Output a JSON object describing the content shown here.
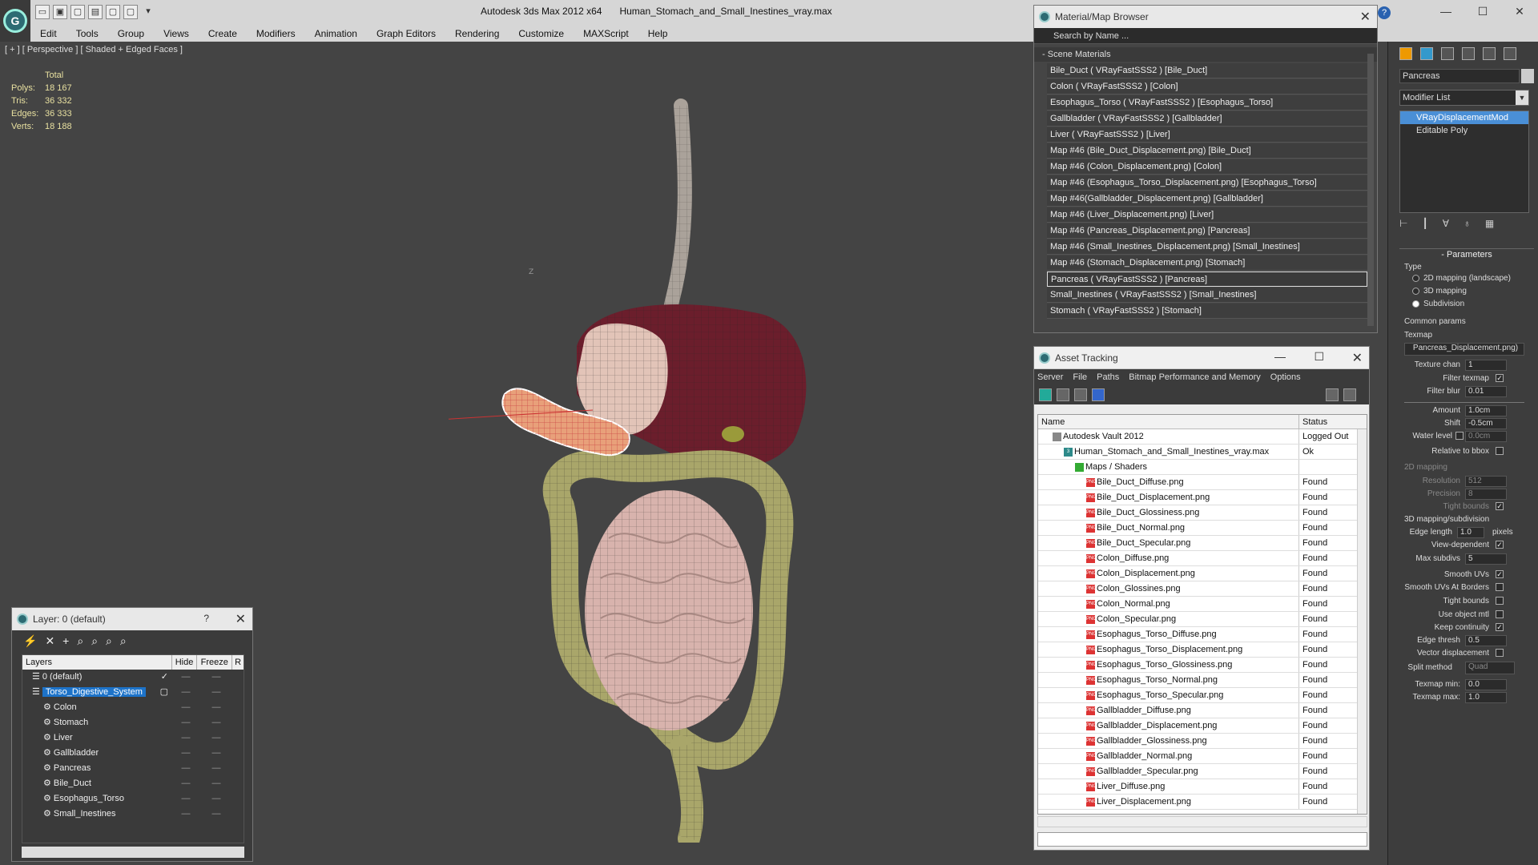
{
  "app": {
    "title": "Autodesk 3ds Max  2012 x64",
    "file": "Human_Stomach_and_Small_Inestines_vray.max",
    "help": "?"
  },
  "menu": [
    "Edit",
    "Tools",
    "Group",
    "Views",
    "Create",
    "Modifiers",
    "Animation",
    "Graph Editors",
    "Rendering",
    "Customize",
    "MAXScript",
    "Help"
  ],
  "viewport": {
    "label": "[ + ] [ Perspective ] [ Shaded + Edged Faces ]",
    "stats_header": "Total",
    "stats": [
      {
        "k": "Polys:",
        "v": "18 167"
      },
      {
        "k": "Tris:",
        "v": "36 332"
      },
      {
        "k": "Edges:",
        "v": "36 333"
      },
      {
        "k": "Verts:",
        "v": "18 188"
      }
    ],
    "axis_z": "Z",
    "axis_x": "X"
  },
  "material_browser": {
    "title": "Material/Map Browser",
    "search_placeholder": "Search by Name ...",
    "section": "Scene Materials",
    "items": [
      "Bile_Duct  ( VRayFastSSS2 )  [Bile_Duct]",
      "Colon  ( VRayFastSSS2 )  [Colon]",
      "Esophagus_Torso  ( VRayFastSSS2 )  [Esophagus_Torso]",
      "Gallbladder  ( VRayFastSSS2 )  [Gallbladder]",
      "Liver  ( VRayFastSSS2 )  [Liver]",
      "Map #46 (Bile_Duct_Displacement.png)  [Bile_Duct]",
      "Map #46 (Colon_Displacement.png)  [Colon]",
      "Map #46 (Esophagus_Torso_Displacement.png)  [Esophagus_Torso]",
      "Map #46(Gallbladder_Displacement.png)  [Gallbladder]",
      "Map #46 (Liver_Displacement.png)  [Liver]",
      "Map #46 (Pancreas_Displacement.png)  [Pancreas]",
      "Map #46 (Small_Inestines_Displacement.png)  [Small_Inestines]",
      "Map #46 (Stomach_Displacement.png)  [Stomach]",
      "Pancreas  ( VRayFastSSS2 )  [Pancreas]",
      "Small_Inestines  ( VRayFastSSS2 )  [Small_Inestines]",
      "Stomach  ( VRayFastSSS2 )  [Stomach]"
    ],
    "selected_index": 13
  },
  "asset_tracking": {
    "title": "Asset Tracking",
    "menu": [
      "Server",
      "File",
      "Paths",
      "Bitmap Performance and Memory",
      "Options"
    ],
    "columns": [
      "Name",
      "Status"
    ],
    "rows": [
      {
        "name": "Autodesk Vault 2012",
        "status": "Logged Out",
        "indent": 1,
        "icon": "vault"
      },
      {
        "name": "Human_Stomach_and_Small_Inestines_vray.max",
        "status": "Ok",
        "indent": 2,
        "icon": "max"
      },
      {
        "name": "Maps / Shaders",
        "status": "",
        "indent": 3,
        "icon": "maps"
      },
      {
        "name": "Bile_Duct_Diffuse.png",
        "status": "Found",
        "indent": 4,
        "icon": "png"
      },
      {
        "name": "Bile_Duct_Displacement.png",
        "status": "Found",
        "indent": 4,
        "icon": "png"
      },
      {
        "name": "Bile_Duct_Glossiness.png",
        "status": "Found",
        "indent": 4,
        "icon": "png"
      },
      {
        "name": "Bile_Duct_Normal.png",
        "status": "Found",
        "indent": 4,
        "icon": "png"
      },
      {
        "name": "Bile_Duct_Specular.png",
        "status": "Found",
        "indent": 4,
        "icon": "png"
      },
      {
        "name": "Colon_Diffuse.png",
        "status": "Found",
        "indent": 4,
        "icon": "png"
      },
      {
        "name": "Colon_Displacement.png",
        "status": "Found",
        "indent": 4,
        "icon": "png"
      },
      {
        "name": "Colon_Glossines.png",
        "status": "Found",
        "indent": 4,
        "icon": "png"
      },
      {
        "name": "Colon_Normal.png",
        "status": "Found",
        "indent": 4,
        "icon": "png"
      },
      {
        "name": "Colon_Specular.png",
        "status": "Found",
        "indent": 4,
        "icon": "png"
      },
      {
        "name": "Esophagus_Torso_Diffuse.png",
        "status": "Found",
        "indent": 4,
        "icon": "png"
      },
      {
        "name": "Esophagus_Torso_Displacement.png",
        "status": "Found",
        "indent": 4,
        "icon": "png"
      },
      {
        "name": "Esophagus_Torso_Glossiness.png",
        "status": "Found",
        "indent": 4,
        "icon": "png"
      },
      {
        "name": "Esophagus_Torso_Normal.png",
        "status": "Found",
        "indent": 4,
        "icon": "png"
      },
      {
        "name": "Esophagus_Torso_Specular.png",
        "status": "Found",
        "indent": 4,
        "icon": "png"
      },
      {
        "name": "Gallbladder_Diffuse.png",
        "status": "Found",
        "indent": 4,
        "icon": "png"
      },
      {
        "name": "Gallbladder_Displacement.png",
        "status": "Found",
        "indent": 4,
        "icon": "png"
      },
      {
        "name": "Gallbladder_Glossiness.png",
        "status": "Found",
        "indent": 4,
        "icon": "png"
      },
      {
        "name": "Gallbladder_Normal.png",
        "status": "Found",
        "indent": 4,
        "icon": "png"
      },
      {
        "name": "Gallbladder_Specular.png",
        "status": "Found",
        "indent": 4,
        "icon": "png"
      },
      {
        "name": "Liver_Diffuse.png",
        "status": "Found",
        "indent": 4,
        "icon": "png"
      },
      {
        "name": "Liver_Displacement.png",
        "status": "Found",
        "indent": 4,
        "icon": "png"
      }
    ]
  },
  "layer_window": {
    "title": "Layer: 0 (default)",
    "help": "?",
    "columns": [
      "Layers",
      "Hide",
      "Freeze",
      "R"
    ],
    "rows": [
      {
        "name": "0 (default)",
        "indent": 1,
        "checked": true,
        "selected": false
      },
      {
        "name": "Torso_Digestive_System",
        "indent": 1,
        "checked": false,
        "selected": true
      },
      {
        "name": "Colon",
        "indent": 2,
        "checked": false,
        "selected": false
      },
      {
        "name": "Stomach",
        "indent": 2,
        "checked": false,
        "selected": false
      },
      {
        "name": "Liver",
        "indent": 2,
        "checked": false,
        "selected": false
      },
      {
        "name": "Gallbladder",
        "indent": 2,
        "checked": false,
        "selected": false
      },
      {
        "name": "Pancreas",
        "indent": 2,
        "checked": false,
        "selected": false
      },
      {
        "name": "Bile_Duct",
        "indent": 2,
        "checked": false,
        "selected": false
      },
      {
        "name": "Esophagus_Torso",
        "indent": 2,
        "checked": false,
        "selected": false
      },
      {
        "name": "Small_Inestines",
        "indent": 2,
        "checked": false,
        "selected": false
      }
    ]
  },
  "command_panel": {
    "object_name": "Pancreas",
    "modifier_list": "Modifier List",
    "stack": [
      "VRayDisplacementMod",
      "Editable Poly"
    ],
    "params": {
      "rollout": "Parameters",
      "type_label": "Type",
      "type_options": [
        "2D mapping (landscape)",
        "3D mapping",
        "Subdivision"
      ],
      "type_selected": 2,
      "common": "Common params",
      "texmap_label": "Texmap",
      "texmap_value": "Pancreas_Displacement.png)",
      "texture_chan_label": "Texture chan",
      "texture_chan": "1",
      "filter_texmap": "Filter texmap",
      "filter_blur_label": "Filter blur",
      "filter_blur": "0.01",
      "amount_label": "Amount",
      "amount": "1.0cm",
      "shift_label": "Shift",
      "shift": "-0.5cm",
      "water_label": "Water level",
      "water": "0.0cm",
      "relative_bbox": "Relative to bbox",
      "map2d": "2D mapping",
      "resolution_label": "Resolution",
      "resolution": "512",
      "precision_label": "Precision",
      "precision": "8",
      "tight_bounds": "Tight bounds",
      "map3d": "3D mapping/subdivision",
      "edge_length_label": "Edge length",
      "edge_length": "1.0",
      "pixels": "pixels",
      "view_dependent": "View-dependent",
      "max_subdivs_label": "Max subdivs",
      "max_subdivs": "5",
      "smooth_uvs": "Smooth UVs",
      "smooth_uvs_borders": "Smooth UVs At Borders",
      "tight_bounds2": "Tight bounds",
      "use_object_mtl": "Use object mtl",
      "keep_continuity": "Keep continuity",
      "edge_thresh_label": "Edge thresh",
      "edge_thresh": "0.5",
      "vector_disp": "Vector displacement",
      "split_method_label": "Split method",
      "split_method": "Quad",
      "texmap_min_label": "Texmap min:",
      "texmap_min": "0.0",
      "texmap_max_label": "Texmap max:",
      "texmap_max": "1.0"
    }
  },
  "colors": {
    "liver": "#6b1e2c",
    "stomach": "#e2c4b8",
    "colon": "#a9a66a",
    "intestine": "#d8b3ad",
    "pancreas": "#e8a07a",
    "selection": "#1d73c9"
  }
}
